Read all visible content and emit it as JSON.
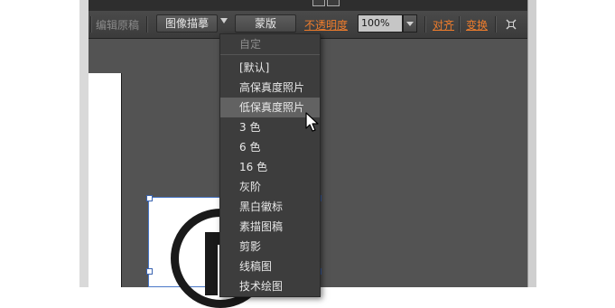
{
  "toolbar": {
    "edit_original_label": "编辑原稿",
    "image_trace_label": "图像描摹",
    "mask_label": "蒙版",
    "opacity_label": "不透明度",
    "opacity_value": "100%",
    "align_label": "对齐",
    "transform_label": "变换"
  },
  "trace_menu": {
    "items": [
      {
        "label": "自定",
        "enabled": false
      },
      {
        "label": "[默认]",
        "enabled": true
      },
      {
        "label": "高保真度照片",
        "enabled": true
      },
      {
        "label": "低保真度照片",
        "enabled": true,
        "highlighted": true
      },
      {
        "label": "3 色",
        "enabled": true
      },
      {
        "label": "6 色",
        "enabled": true
      },
      {
        "label": "16 色",
        "enabled": true
      },
      {
        "label": "灰阶",
        "enabled": true
      },
      {
        "label": "黑白徽标",
        "enabled": true
      },
      {
        "label": "素描图稿",
        "enabled": true
      },
      {
        "label": "剪影",
        "enabled": true
      },
      {
        "label": "线稿图",
        "enabled": true
      },
      {
        "label": "技术绘图",
        "enabled": true
      }
    ]
  },
  "colors": {
    "panel_bg": "#535353",
    "toolbar_bg": "#404040",
    "menu_bg": "#3d3d3d",
    "menu_highlight": "#626262",
    "link_orange": "#f07d2c",
    "selection_blue": "#4a78c8"
  },
  "icons": {
    "trace_dropdown": "chevron-down-icon",
    "opacity_dropdown": "chevron-down-icon",
    "transform_each": "crosshair-icon",
    "cursor": "arrow-pointer-icon"
  }
}
